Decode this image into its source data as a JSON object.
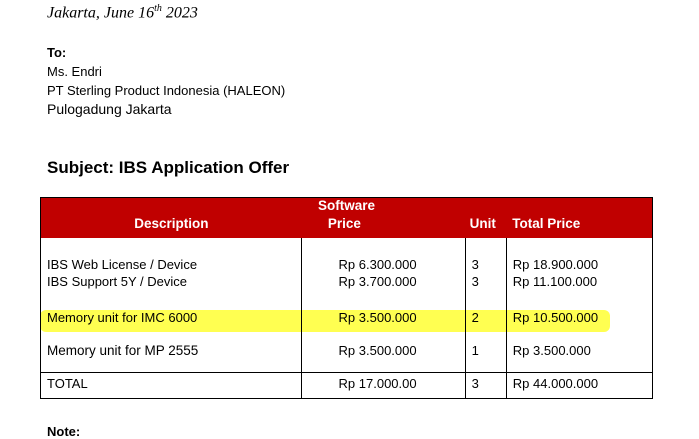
{
  "letter": {
    "date_prefix": "Jakarta, June 16",
    "date_sup": "th",
    "date_year": "2023",
    "to_label": "To:",
    "recipient_name": "Ms. Endri",
    "recipient_company": "PT Sterling Product Indonesia (HALEON)",
    "recipient_city": "Pulogadung Jakarta",
    "subject": "Subject: IBS Application Offer",
    "note_label": "Note:"
  },
  "table": {
    "group_header": "Software",
    "headers": [
      "Description",
      "Price",
      "Unit",
      "Total Price"
    ],
    "rows": [
      {
        "description": "IBS Web License / Device",
        "price": "Rp 6.300.000",
        "unit": "3",
        "total": "Rp 18.900.000"
      },
      {
        "description": "IBS Support 5Y / Device",
        "price": "Rp 3.700.000",
        "unit": "3",
        "total": "Rp 11.100.000"
      },
      {
        "description": "Memory unit for IMC 6000",
        "price": "Rp 3.500.000",
        "unit": "2",
        "total": "Rp 10.500.000"
      },
      {
        "description": "Memory unit for MP 2555",
        "price": "Rp 3.500.000",
        "unit": "1",
        "total": "Rp 3.500.000"
      }
    ],
    "total_row": {
      "description": "TOTAL",
      "price": "Rp 17.000.00",
      "unit": "3",
      "total": "Rp 44.000.000"
    },
    "header_color": "#c00000",
    "highlight_color": "#ffff33"
  }
}
